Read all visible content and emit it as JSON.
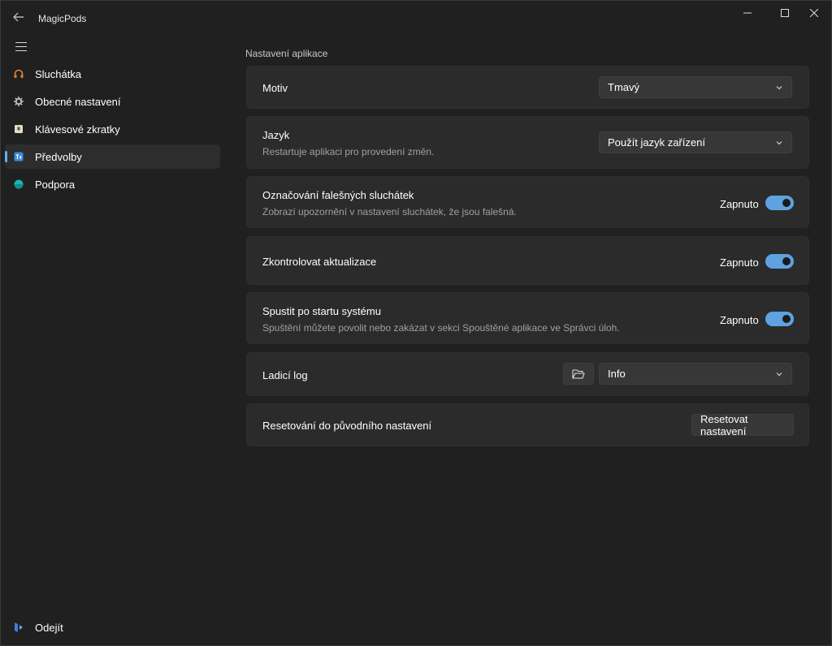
{
  "app": {
    "title": "MagicPods"
  },
  "sidebar": {
    "items": [
      {
        "label": "Sluchátka",
        "icon": "headphones-icon",
        "active": false
      },
      {
        "label": "Obecné nastavení",
        "icon": "gear-icon",
        "active": false
      },
      {
        "label": "Klávesové zkratky",
        "icon": "keyboard-icon",
        "active": false
      },
      {
        "label": "Předvolby",
        "icon": "preferences-icon",
        "active": true
      },
      {
        "label": "Podpora",
        "icon": "support-icon",
        "active": false
      }
    ],
    "footer": {
      "label": "Odejít",
      "icon": "exit-icon"
    }
  },
  "main": {
    "section_title": "Nastavení aplikace",
    "theme": {
      "title": "Motiv",
      "value": "Tmavý"
    },
    "language": {
      "title": "Jazyk",
      "description": "Restartuje aplikaci pro provedení změn.",
      "value": "Použít jazyk zařízení"
    },
    "fake_detection": {
      "title": "Označování falešných sluchátek",
      "description": "Zobrazí upozornění v nastavení sluchátek, že jsou falešná.",
      "state_label": "Zapnuto",
      "on": true
    },
    "check_updates": {
      "title": "Zkontrolovat aktualizace",
      "state_label": "Zapnuto",
      "on": true
    },
    "autostart": {
      "title": "Spustit po startu systému",
      "description": "Spuštění můžete povolit nebo zakázat v sekci Spouštěné aplikace ve Správci úloh.",
      "state_label": "Zapnuto",
      "on": true
    },
    "debug_log": {
      "title": "Ladicí log",
      "value": "Info"
    },
    "reset": {
      "title": "Resetování do původního nastavení",
      "button_label": "Resetovat nastavení"
    }
  },
  "colors": {
    "background": "#202020",
    "card": "#2b2b2b",
    "accent": "#5ea2e0"
  }
}
